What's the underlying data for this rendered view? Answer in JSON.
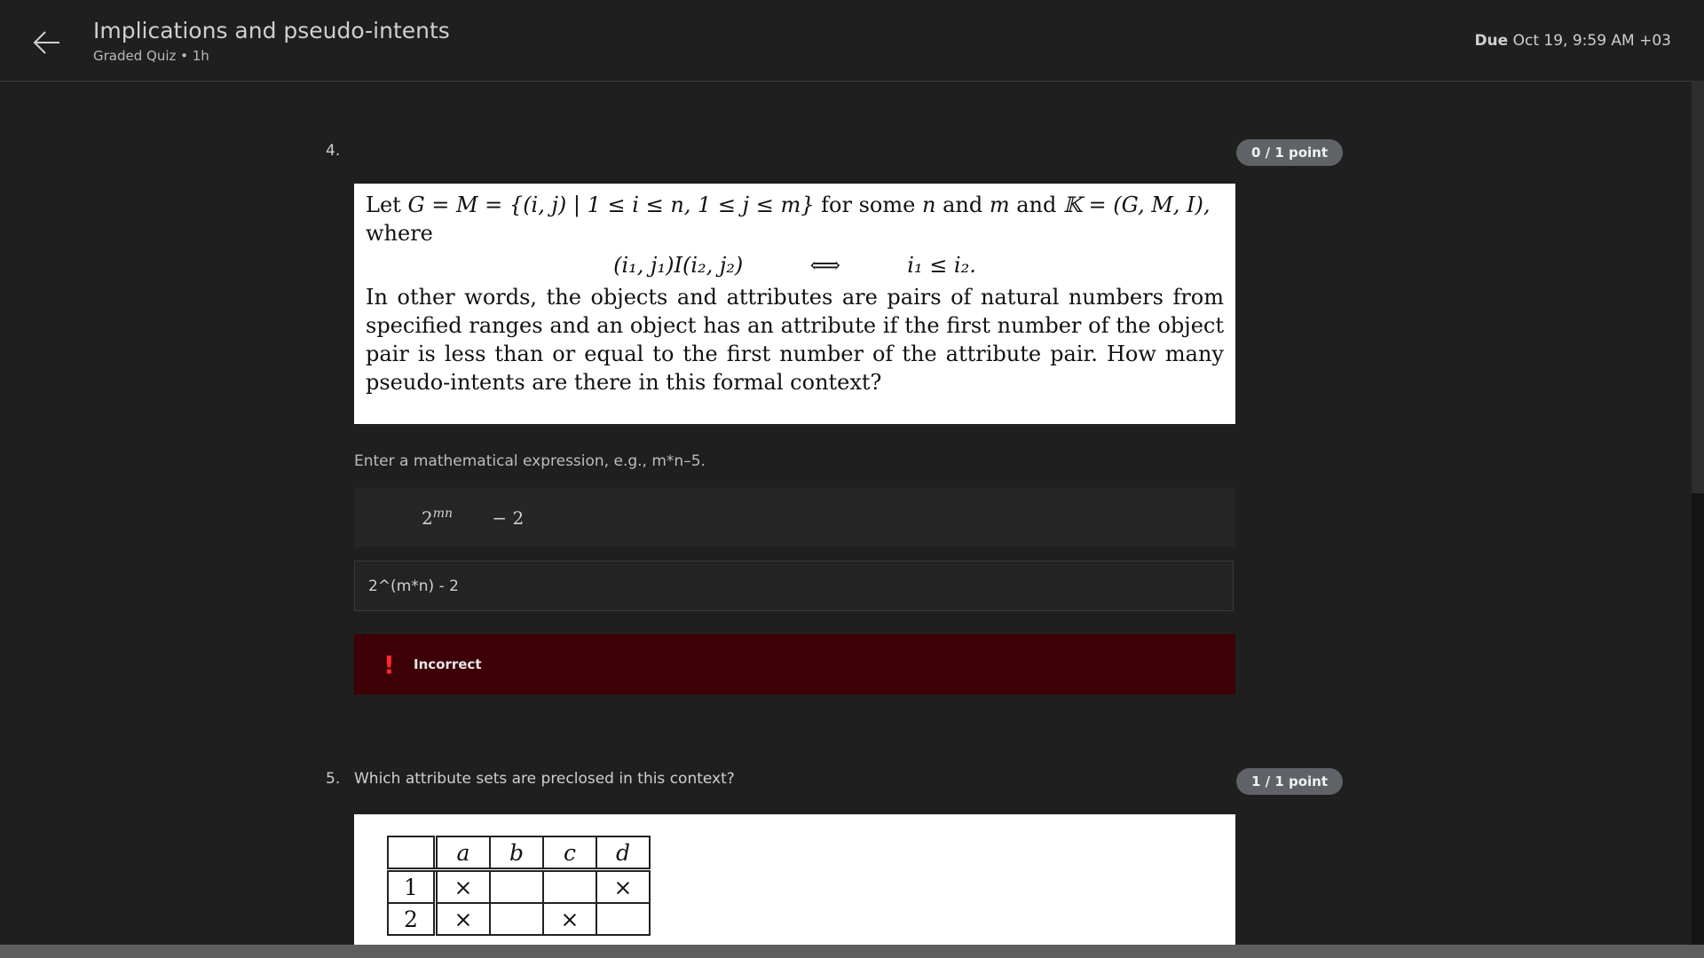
{
  "header": {
    "title": "Implications and pseudo-intents",
    "subtitle": "Graded Quiz • 1h",
    "due_label": "Due",
    "due_value": "Oct 19, 9:59 AM +03"
  },
  "question4": {
    "number": "4.",
    "points": "0 / 1 point",
    "text_lead": "Let",
    "text_set": "G = M = {(i, j) | 1 ≤ i ≤ n, 1 ≤ j ≤ m}",
    "text_mid1": "for some",
    "var_n": "n",
    "text_and": "and",
    "var_m": "m",
    "text_and2": "and",
    "context_def": "𝕂 = (G, M, I),",
    "text_where": "where",
    "relation_left": "(i₁, j₁)I(i₂, j₂)",
    "relation_iff": "⟺",
    "relation_right": "i₁ ≤ i₂.",
    "paragraph": "In other words, the objects and attributes are pairs of natural numbers from specified ranges and an object has an attribute if the first number of the object pair is less than or equal to the first number of the attribute pair. How many pseudo-intents are there in this formal context?",
    "hint": "Enter a mathematical expression, e.g., m*n–5.",
    "preview_base": "2",
    "preview_exp": "mn",
    "preview_rest": "− 2",
    "answer_value": "2^(m*n) - 2",
    "feedback_icon": "!",
    "feedback": "Incorrect"
  },
  "question5": {
    "number": "5.",
    "text": "Which attribute sets are preclosed in this context?",
    "points": "1 / 1 point",
    "table": {
      "headers": [
        "",
        "a",
        "b",
        "c",
        "d"
      ],
      "rows": [
        [
          "1",
          "×",
          "",
          "",
          "×"
        ],
        [
          "2",
          "×",
          "",
          "×",
          ""
        ]
      ]
    }
  },
  "icons": {
    "back": "arrow-left-icon",
    "feedback": "exclamation-icon"
  },
  "colors": {
    "background": "#1f1f1f",
    "incorrect": "#3d0007",
    "badge": "#5f6368"
  }
}
